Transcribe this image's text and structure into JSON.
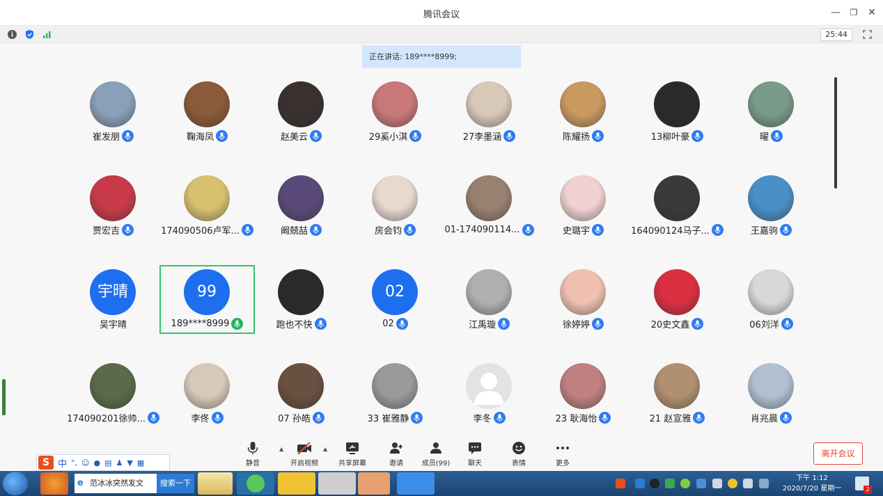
{
  "window": {
    "title": "腾讯会议",
    "minimize": "—",
    "restore": "❐",
    "close": "✕"
  },
  "info_bar": {
    "timer": "25:44"
  },
  "speaking_banner": "正在讲话: 189****8999;",
  "participants": [
    {
      "name": "崔发朋",
      "avatar": "photo",
      "color": "#8aa0b8"
    },
    {
      "name": "鞠海凤",
      "avatar": "photo",
      "color": "#8a5a3a"
    },
    {
      "name": "赵美云",
      "avatar": "photo",
      "color": "#3a3030"
    },
    {
      "name": "29奚小淇",
      "avatar": "photo",
      "color": "#c87878"
    },
    {
      "name": "27李墨涵",
      "avatar": "photo",
      "color": "#d8c8b8"
    },
    {
      "name": "陈耀扬",
      "avatar": "photo",
      "color": "#c89a60"
    },
    {
      "name": "13柳叶豪",
      "avatar": "photo",
      "color": "#2a2a28"
    },
    {
      "name": "曜",
      "avatar": "photo",
      "color": "#7a9a8a"
    },
    {
      "name": "贾宏吉",
      "avatar": "photo",
      "color": "#c83a4a"
    },
    {
      "name": "174090506卢军...",
      "avatar": "photo",
      "color": "#d8c070"
    },
    {
      "name": "阚兢喆",
      "avatar": "photo",
      "color": "#5a4a7a"
    },
    {
      "name": "房会钧",
      "avatar": "photo",
      "color": "#e8d8d0"
    },
    {
      "name": "01-174090114...",
      "avatar": "photo",
      "color": "#9a8070"
    },
    {
      "name": "史璐宇",
      "avatar": "photo",
      "color": "#f0d0d0"
    },
    {
      "name": "164090124马子...",
      "avatar": "photo",
      "color": "#3a3a3a"
    },
    {
      "name": "王嘉驹",
      "avatar": "photo",
      "color": "#4a90c8"
    },
    {
      "name": "吴宇晴",
      "avatar": "text",
      "text": "宇晴",
      "mic": false
    },
    {
      "name": "189****8999",
      "avatar": "text",
      "text": "99",
      "mic_active": true
    },
    {
      "name": "跑也不快",
      "avatar": "photo",
      "color": "#2a2a2a"
    },
    {
      "name": "02",
      "avatar": "text",
      "text": "02"
    },
    {
      "name": "江禹璇",
      "avatar": "photo",
      "color": "#b0b0b0"
    },
    {
      "name": "徐婷婷",
      "avatar": "photo",
      "color": "#f0c0b0"
    },
    {
      "name": "20史文鑫",
      "avatar": "photo",
      "color": "#d83040"
    },
    {
      "name": "06刘洋",
      "avatar": "photo",
      "color": "#d8d8d8"
    },
    {
      "name": "174090201徐帅...",
      "avatar": "photo",
      "color": "#5a6a4a"
    },
    {
      "name": "李佟",
      "avatar": "photo",
      "color": "#d8c8b8"
    },
    {
      "name": "07 孙皓",
      "avatar": "photo",
      "color": "#6a5040"
    },
    {
      "name": "33 崔雅静",
      "avatar": "photo",
      "color": "#9a9a9a"
    },
    {
      "name": "李冬",
      "avatar": "gray"
    },
    {
      "name": "23  耿海怡",
      "avatar": "photo",
      "color": "#c08080"
    },
    {
      "name": "21 赵宣雅",
      "avatar": "photo",
      "color": "#b09070"
    },
    {
      "name": "肖兆晨",
      "avatar": "photo",
      "color": "#b0c0d0"
    }
  ],
  "toolbar": [
    {
      "label": "静音",
      "icon": "microphone-icon"
    },
    {
      "label": "开启视频",
      "icon": "video-off-icon"
    },
    {
      "label": "共享屏幕",
      "icon": "share-screen-icon"
    },
    {
      "label": "邀请",
      "icon": "invite-icon"
    },
    {
      "label": "成员(99)",
      "icon": "members-icon"
    },
    {
      "label": "聊天",
      "icon": "chat-icon"
    },
    {
      "label": "表情",
      "icon": "emoji-icon"
    },
    {
      "label": "更多",
      "icon": "more-icon"
    }
  ],
  "leave_button": "离开会议",
  "ime": {
    "mode": "中",
    "punct": "°,"
  },
  "taskbar": {
    "search_text": "范冰冰突然发文",
    "search_button": "搜索一下",
    "clock_time": "下午 1:12",
    "clock_date": "2020/7/20 星期一",
    "notify_count": "2"
  }
}
